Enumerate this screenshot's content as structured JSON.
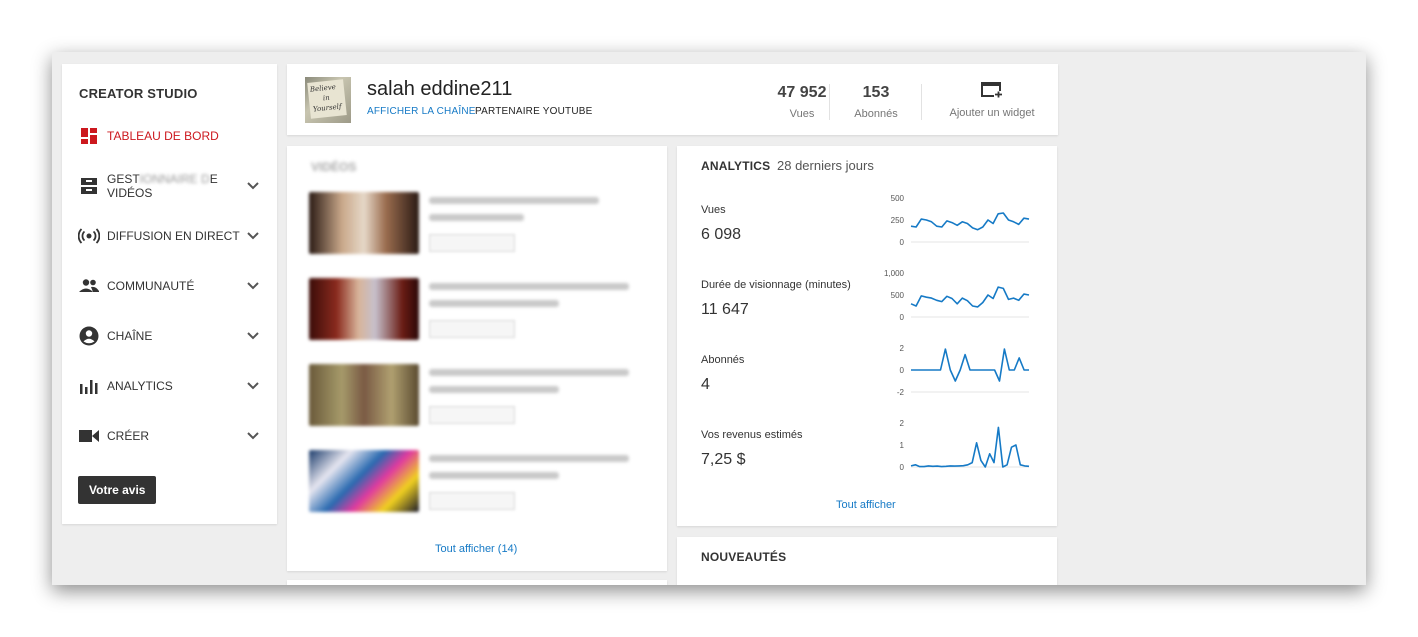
{
  "sidebar": {
    "title": "CREATOR STUDIO",
    "items": [
      {
        "label": "TABLEAU DE BORD",
        "icon": "dashboard-icon",
        "active": true,
        "chevron": false
      },
      {
        "label_pre": "GEST",
        "label_blur": "IONNAIRE D",
        "label_post": "E VIDÉOS",
        "icon": "video-manager-icon",
        "chevron": true
      },
      {
        "label": "DIFFUSION EN DIRECT",
        "icon": "live-broadcast-icon",
        "chevron": true
      },
      {
        "label": "COMMUNAUTÉ",
        "icon": "community-icon",
        "chevron": true
      },
      {
        "label": "CHAÎNE",
        "icon": "channel-icon",
        "chevron": true
      },
      {
        "label": "ANALYTICS",
        "icon": "analytics-icon",
        "chevron": true
      },
      {
        "label": "CRÉER",
        "icon": "create-icon",
        "chevron": true
      }
    ],
    "feedback_label": "Votre avis"
  },
  "header": {
    "channel_name": "salah eddine211",
    "view_channel": "AFFICHER LA CHAÎNE",
    "partner": "PARTENAIRE YOUTUBE",
    "avatar_text": [
      "Believe",
      "in",
      "Yourself"
    ],
    "stats": [
      {
        "value": "47 952",
        "label": "Vues"
      },
      {
        "value": "153",
        "label": "Abonnés"
      }
    ],
    "widget_label": "Ajouter un widget"
  },
  "videos": {
    "title": "VIDÉOS",
    "see_all": "Tout afficher (14)"
  },
  "analytics": {
    "title": "ANALYTICS",
    "period": "28 derniers jours",
    "see_all": "Tout afficher",
    "accent": "#167ac6",
    "metrics": [
      {
        "label": "Vues",
        "value": "6 098"
      },
      {
        "label": "Durée de visionnage (minutes)",
        "value": "11 647"
      },
      {
        "label": "Abonnés",
        "value": "4"
      },
      {
        "label": "Vos revenus estimés",
        "value": "7,25 $"
      }
    ]
  },
  "chart_data": [
    {
      "type": "line",
      "title": "",
      "ylim": [
        0,
        500
      ],
      "yticks": [
        "500",
        "250",
        "0"
      ],
      "values": [
        180,
        170,
        260,
        250,
        230,
        180,
        170,
        240,
        220,
        190,
        230,
        210,
        160,
        140,
        170,
        250,
        210,
        320,
        330,
        250,
        230,
        200,
        270,
        260
      ]
    },
    {
      "type": "line",
      "title": "",
      "ylim": [
        0,
        1000
      ],
      "yticks": [
        "1,000",
        "500",
        "0"
      ],
      "values": [
        300,
        250,
        480,
        450,
        430,
        380,
        350,
        470,
        420,
        300,
        430,
        370,
        250,
        230,
        330,
        500,
        420,
        680,
        650,
        400,
        430,
        380,
        520,
        500
      ]
    },
    {
      "type": "line",
      "title": "",
      "ylim": [
        -2,
        2
      ],
      "yticks": [
        "2",
        "0",
        "-2"
      ],
      "values": [
        0,
        0,
        0,
        0,
        0,
        0,
        0,
        1.9,
        0,
        -1,
        0,
        1.4,
        0,
        0,
        0,
        0,
        0,
        0,
        -1,
        1.9,
        0,
        0,
        1.1,
        0,
        0
      ]
    },
    {
      "type": "line",
      "title": "",
      "ylim": [
        0,
        2
      ],
      "yticks": [
        "2",
        "1",
        "0"
      ],
      "values": [
        0.05,
        0.1,
        0.02,
        0.02,
        0.05,
        0.03,
        0.04,
        0.02,
        0.03,
        0.05,
        0.04,
        0.05,
        0.06,
        0.1,
        0.2,
        1.1,
        0.3,
        0,
        0.6,
        0.2,
        1.8,
        0,
        0.1,
        0.9,
        1.0,
        0.1,
        0.05,
        0.03
      ]
    }
  ]
}
